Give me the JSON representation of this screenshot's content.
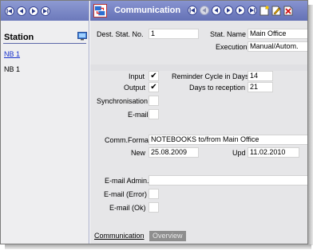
{
  "sidebar": {
    "title": "Station",
    "link": "NB 1",
    "item": "NB 1"
  },
  "header": {
    "title": "Communication"
  },
  "form": {
    "dest_stat_no": {
      "label": "Dest. Stat. No.",
      "value": "1"
    },
    "stat_name": {
      "label": "Stat. Name",
      "value": "Main Office"
    },
    "execution": {
      "label": "Execution",
      "value": "Manual/Autom."
    },
    "input": {
      "label": "Input",
      "checked": "✔"
    },
    "output": {
      "label": "Output",
      "checked": "✔"
    },
    "synchronisation": {
      "label": "Synchronisation",
      "checked": ""
    },
    "email": {
      "label": "E-mail",
      "checked": ""
    },
    "reminder_cycle": {
      "label": "Reminder Cycle in Days",
      "value": "14"
    },
    "days_to_reception": {
      "label": "Days to reception",
      "value": "21"
    },
    "comm_format": {
      "label": "Comm.Format",
      "value": "NOTEBOOKS to/from Main Office"
    },
    "new": {
      "label": "New",
      "value": "25.08.2009"
    },
    "upd": {
      "label": "Upd",
      "value": "11.02.2010"
    },
    "email_admin": {
      "label": "E-mail Admin.",
      "value": ""
    },
    "email_error": {
      "label": "E-mail (Error)",
      "value": ""
    },
    "email_ok": {
      "label": "E-mail (Ok)",
      "value": ""
    }
  },
  "tabs": {
    "active": "Communication",
    "inactive": "Overview"
  },
  "colors": {
    "toolbar": "#7683c4",
    "panel_bg": "#e6e6e8",
    "sidebar_bg": "#eeeef0",
    "link": "#1a33cc"
  }
}
